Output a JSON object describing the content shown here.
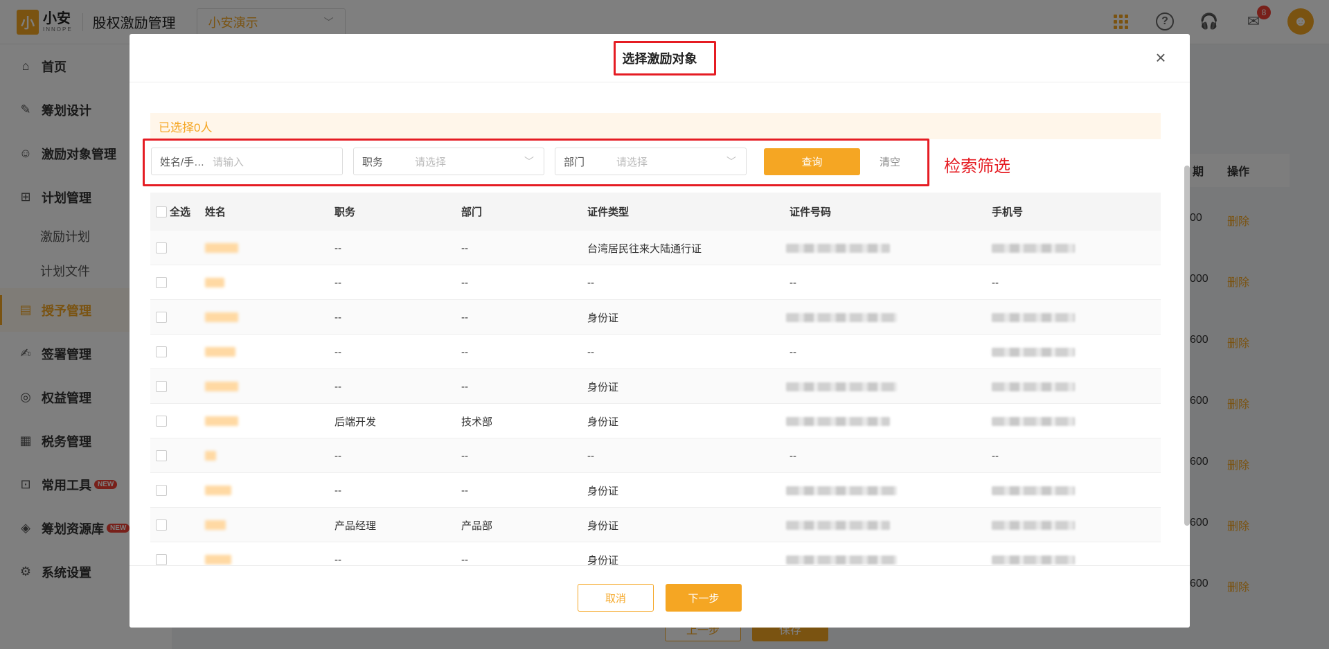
{
  "app": {
    "logo_mark": "小",
    "logo_name": "小安",
    "logo_sub": "INNOPE",
    "title": "股权激励管理",
    "company": "小安演示",
    "notification_count": "8"
  },
  "sidebar": {
    "items": [
      {
        "label": "首页",
        "icon": "home-icon"
      },
      {
        "label": "筹划设计",
        "icon": "edit-icon"
      },
      {
        "label": "激励对象管理",
        "icon": "users-icon"
      },
      {
        "label": "计划管理",
        "icon": "grid-icon"
      },
      {
        "label": "激励计划"
      },
      {
        "label": "计划文件"
      },
      {
        "label": "授予管理",
        "icon": "book-icon"
      },
      {
        "label": "签署管理",
        "icon": "sign-icon"
      },
      {
        "label": "权益管理",
        "icon": "equity-icon"
      },
      {
        "label": "税务管理",
        "icon": "tax-icon"
      },
      {
        "label": "常用工具",
        "icon": "toolbox-icon",
        "tag": "NEW"
      },
      {
        "label": "筹划资源库",
        "icon": "layers-icon",
        "tag": "NEW"
      },
      {
        "label": "系统设置",
        "icon": "settings-icon"
      }
    ]
  },
  "background": {
    "col_period": "期",
    "col_action": "操作",
    "values": [
      "00",
      "000",
      "600",
      "600",
      "600",
      "600",
      "600"
    ],
    "delete_label": "删除",
    "prev_label": "上一步",
    "save_label": "保存"
  },
  "modal": {
    "title": "选择激励对象",
    "selected_text": "已选择0人",
    "annotation": "检索筛选",
    "filters": {
      "name_label": "姓名/手…",
      "name_placeholder": "请输入",
      "position_label": "职务",
      "position_placeholder": "请选择",
      "dept_label": "部门",
      "dept_placeholder": "请选择",
      "query_label": "查询",
      "clear_label": "清空"
    },
    "table": {
      "select_all": "全选",
      "columns": [
        "姓名",
        "职务",
        "部门",
        "证件类型",
        "证件号码",
        "手机号"
      ],
      "rows": [
        {
          "position": "--",
          "dept": "--",
          "id_type": "台湾居民往来大陆通行证",
          "id_no": "",
          "phone": ""
        },
        {
          "position": "--",
          "dept": "--",
          "id_type": "--",
          "id_no": "--",
          "phone": "--"
        },
        {
          "position": "--",
          "dept": "--",
          "id_type": "身份证",
          "id_no": "",
          "phone": ""
        },
        {
          "position": "--",
          "dept": "--",
          "id_type": "--",
          "id_no": "--",
          "phone": ""
        },
        {
          "position": "--",
          "dept": "--",
          "id_type": "身份证",
          "id_no": "",
          "phone": ""
        },
        {
          "position": "后端开发",
          "dept": "技术部",
          "id_type": "身份证",
          "id_no": "",
          "phone": ""
        },
        {
          "position": "--",
          "dept": "--",
          "id_type": "--",
          "id_no": "--",
          "phone": "--"
        },
        {
          "position": "--",
          "dept": "--",
          "id_type": "身份证",
          "id_no": "",
          "phone": ""
        },
        {
          "position": "产品经理",
          "dept": "产品部",
          "id_type": "身份证",
          "id_no": "",
          "phone": ""
        },
        {
          "position": "--",
          "dept": "--",
          "id_type": "身份证",
          "id_no": "",
          "phone": ""
        }
      ]
    },
    "cancel_label": "取消",
    "next_label": "下一步"
  },
  "colors": {
    "accent": "#f5a623",
    "annotation_red": "#e51c23",
    "danger": "#f04134"
  }
}
